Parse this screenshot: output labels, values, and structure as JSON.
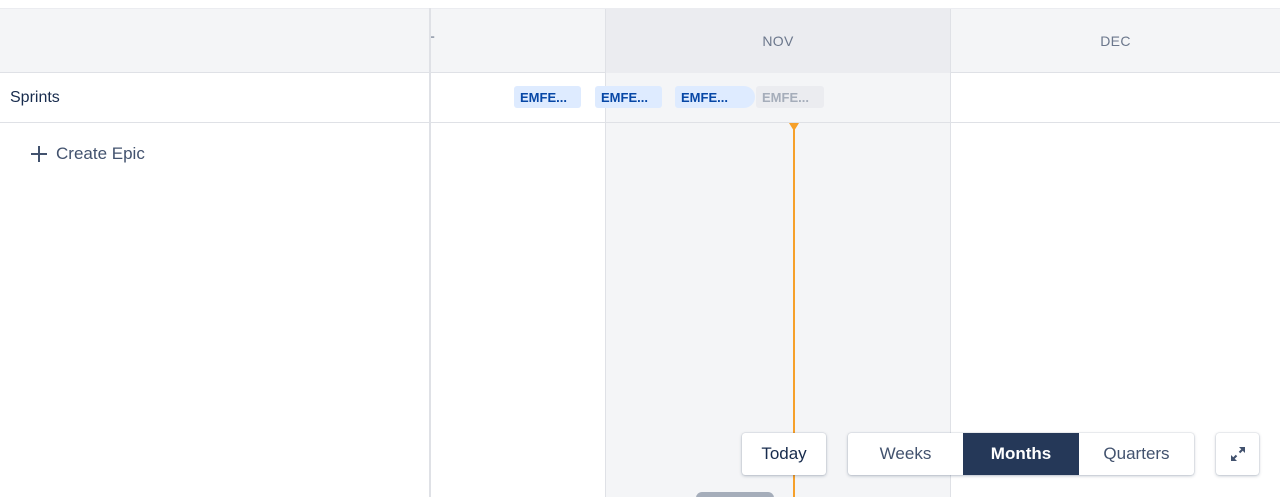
{
  "timeline": {
    "months": {
      "oct": "T",
      "nov": "NOV",
      "dec": "DEC"
    }
  },
  "sprints": {
    "label": "Sprints",
    "chips": [
      {
        "label": "EMFE...",
        "state": "active"
      },
      {
        "label": "EMFE...",
        "state": "active"
      },
      {
        "label": "EMFE...",
        "state": "active"
      },
      {
        "label": "EMFE...",
        "state": "future"
      }
    ]
  },
  "actions": {
    "create_epic": "Create Epic"
  },
  "controls": {
    "today": "Today",
    "views": {
      "weeks": "Weeks",
      "months": "Months",
      "quarters": "Quarters"
    },
    "selected_view": "Months"
  },
  "icons": {
    "create": "plus-icon",
    "expand": "expand-icon",
    "today_marker": "today-marker"
  },
  "colors": {
    "today_marker": "#f6a02a",
    "selected_view_bg": "#253858",
    "sprint_active_bg": "#deebff",
    "sprint_active_text": "#0747a6",
    "sprint_future_bg": "#ebecf0",
    "sprint_future_text": "#a5adba"
  }
}
